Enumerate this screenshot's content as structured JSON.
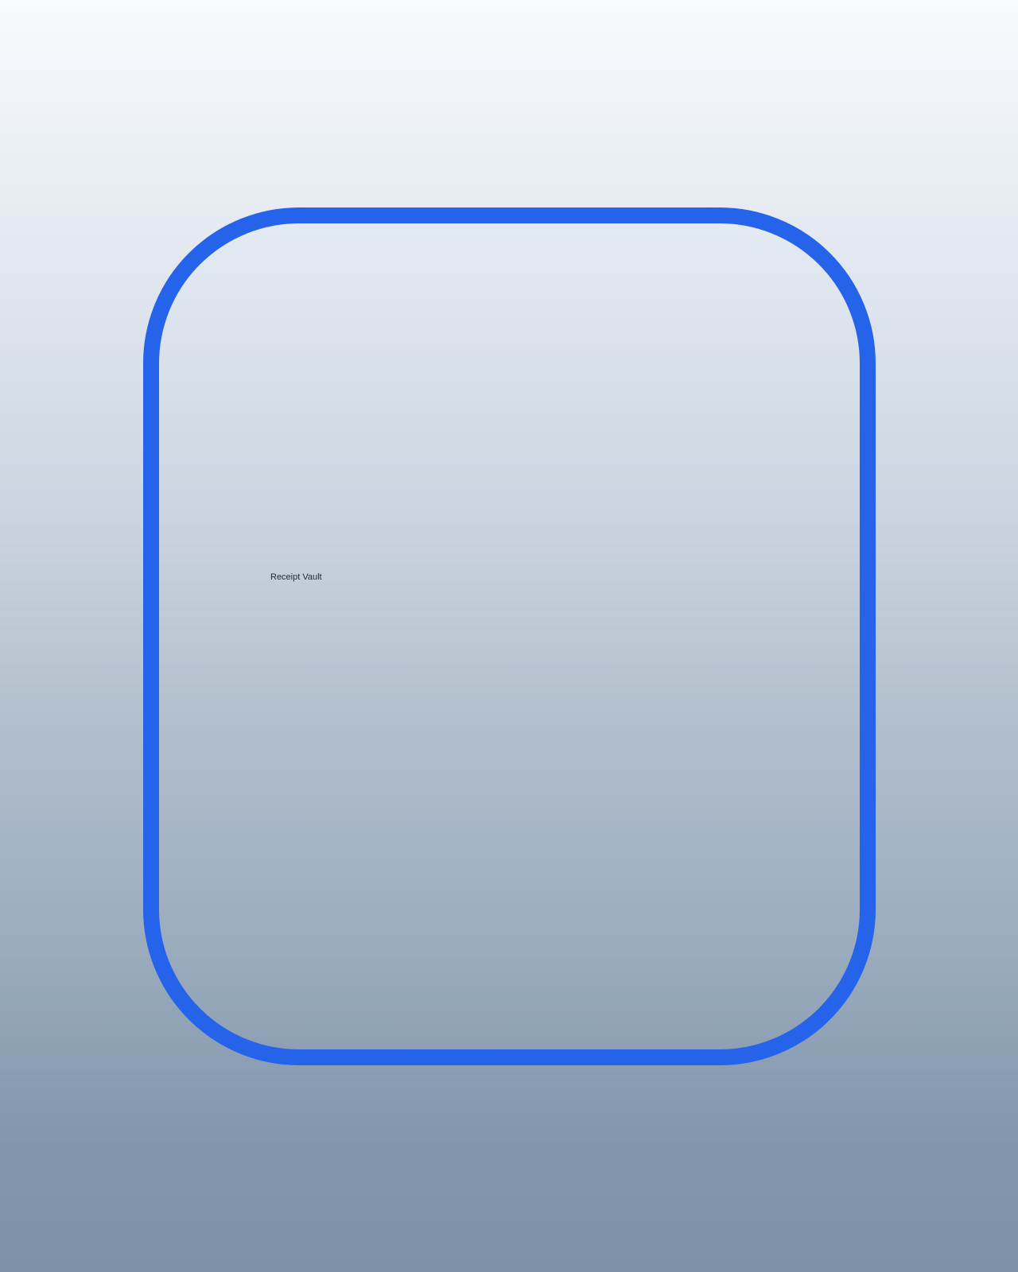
{
  "app": {
    "title": "Receipt Vault"
  },
  "colors": {
    "frame_accent": "#2563eb",
    "background_top": "#f8fafc",
    "background_bottom": "#7d91a8",
    "title_text": "#1e293b"
  }
}
